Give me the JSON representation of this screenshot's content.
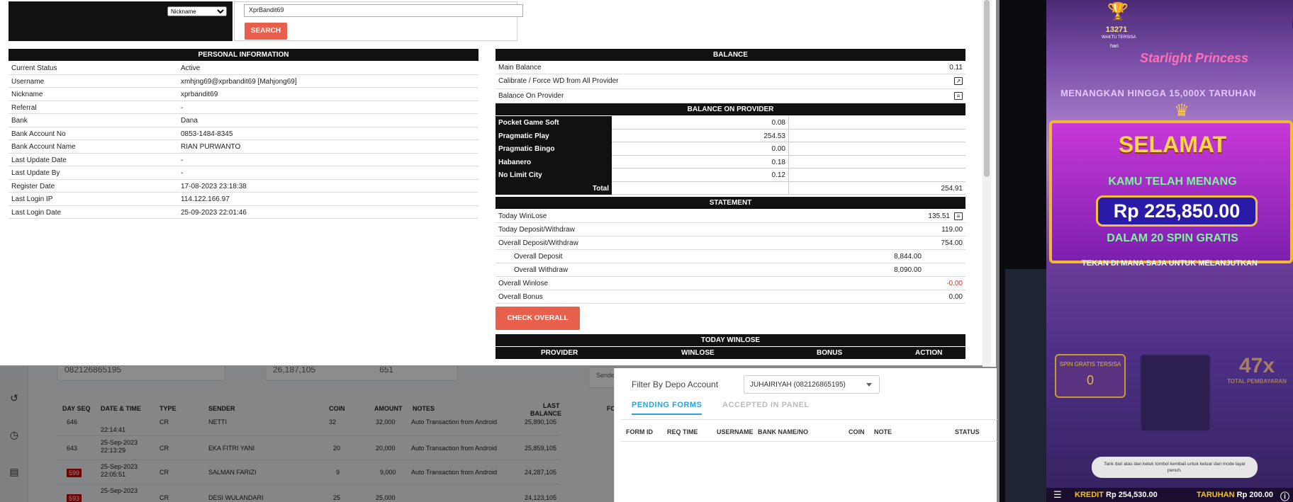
{
  "search": {
    "filter_option": "Nickname",
    "query": "XprBandit69",
    "button": "SEARCH"
  },
  "personal": {
    "title": "PERSONAL INFORMATION",
    "rows": [
      {
        "k": "Current Status",
        "v": "Active"
      },
      {
        "k": "Username",
        "v": "xmhjng69@xprbandit69  [Mahjong69]"
      },
      {
        "k": "Nickname",
        "v": "xprbandit69"
      },
      {
        "k": "Referral",
        "v": "-"
      },
      {
        "k": "Bank",
        "v": "Dana"
      },
      {
        "k": "Bank Account No",
        "v": "0853-1484-8345"
      },
      {
        "k": "Bank Account Name",
        "v": "RIAN PURWANTO"
      },
      {
        "k": "Last Update Date",
        "v": "-"
      },
      {
        "k": "Last Update By",
        "v": "-"
      },
      {
        "k": "Register Date",
        "v": "17-08-2023 23:18:38"
      },
      {
        "k": "Last Login IP",
        "v": "114.122.166.97"
      },
      {
        "k": "Last Login Date",
        "v": "25-09-2023 22:01:46"
      }
    ]
  },
  "balance": {
    "title": "BALANCE",
    "main_label": "Main Balance",
    "main_value": "0.11",
    "calibrate_label": "Calibrate / Force WD from All Provider",
    "on_provider_label": "Balance On Provider",
    "provider_title": "BALANCE ON PROVIDER",
    "providers": [
      {
        "name": "Pocket Game Soft",
        "value": "0.08"
      },
      {
        "name": "Pragmatic Play",
        "value": "254.53"
      },
      {
        "name": "Pragmatic Bingo",
        "value": "0.00"
      },
      {
        "name": "Habanero",
        "value": "0.18"
      },
      {
        "name": "No Limit City",
        "value": "0.12"
      }
    ],
    "total_label": "Total",
    "total_value": "254.91"
  },
  "statement": {
    "title": "STATEMENT",
    "today_winlose_label": "Today WinLose",
    "today_winlose": "135.51",
    "today_dw_label": "Today Deposit/Withdraw",
    "today_dw": "119.00",
    "overall_dw_label": "Overall Deposit/Withdraw",
    "overall_dw": "754.00",
    "overall_deposit_label": "Overall Deposit",
    "overall_deposit": "8,844.00",
    "overall_withdraw_label": "Overall Withdraw",
    "overall_withdraw": "8,090.00",
    "overall_winlose_label": "Overall Winlose",
    "overall_winlose": "-0.00",
    "overall_bonus_label": "Overall Bonus",
    "overall_bonus": "0.00",
    "check_button": "CHECK OVERALL"
  },
  "today_winlose": {
    "title": "TODAY WINLOSE",
    "cols": [
      "PROVIDER",
      "WINLOSE",
      "BONUS",
      "ACTION"
    ]
  },
  "background": {
    "card1": "082126865195",
    "card2a": "26,187,105",
    "card2b": "651",
    "sender_stub": "Sende",
    "headers": {
      "seq": "DAY SEQ",
      "dt": "DATE & TIME",
      "type": "TYPE",
      "sender": "SENDER",
      "coin": "COIN",
      "amount": "AMOUNT",
      "notes": "NOTES",
      "last1": "LAST",
      "last2": "BALANCE",
      "fc": "FC"
    },
    "rows": [
      {
        "seq": "646",
        "dt": "22:14:41",
        "type": "CR",
        "sender": "NETTI",
        "coin": "32",
        "amount": "32,000",
        "notes": "Auto Transaction from Android",
        "bal": "25,890,105"
      },
      {
        "seq": "643",
        "dt": "25-Sep-2023 22:13:29",
        "type": "CR",
        "sender": "EKA FITRI YANI",
        "coin": "20",
        "amount": "20,000",
        "notes": "Auto Transaction from Android",
        "bal": "25,859,105"
      },
      {
        "seq": "599",
        "dt": "25-Sep-2023 22:05:51",
        "type": "CR",
        "sender": "SALMAN FARIZI",
        "coin": "9",
        "amount": "9,000",
        "notes": "Auto Transaction from Android",
        "bal": "24,287,105"
      },
      {
        "seq": "593",
        "dt": "25-Sep-2023",
        "type": "CR",
        "sender": "DESI WULANDARI",
        "coin": "25",
        "amount": "25,000",
        "notes": "",
        "bal": "24,123,105"
      }
    ]
  },
  "filter": {
    "label": "Filter By Depo Account",
    "selected": "JUHAIRIYAH (082126865195)",
    "tab_pending": "PENDING FORMS",
    "tab_accepted": "ACCEPTED IN PANEL",
    "cols": [
      "FORM ID",
      "REQ TIME",
      "USERNAME",
      "BANK NAME/NO",
      "COIN",
      "NOTE",
      "STATUS"
    ]
  },
  "game": {
    "score": "13271",
    "tersisa": "WAKTU TERSISA",
    "hari": "hari",
    "logo": "Starlight Princess",
    "menangkan": "MENANGKAN HINGGA 15,000X TARUHAN",
    "selamat": "SELAMAT",
    "telah_menang": "KAMU TELAH MENANG",
    "amount": "Rp 225,850.00",
    "dalam": "DALAM 20 SPIN GRATIS",
    "tekan": "TEKAN DI MANA SAJA UNTUK MELANJUTKAN",
    "spin_left": "SPIN GRATIS TERSISA",
    "spin_count": "0",
    "multiplier": "47x",
    "total": "TOTAL PEMBAYARAN",
    "toast": "Tarik dari atas dan ketuk tombol kembali untuk keluar dari mode layar penuh.",
    "kredit_label": "KREDIT",
    "kredit": "Rp 254,530.00",
    "taruhan_label": "TARUHAN",
    "taruhan": "Rp 200.00"
  }
}
